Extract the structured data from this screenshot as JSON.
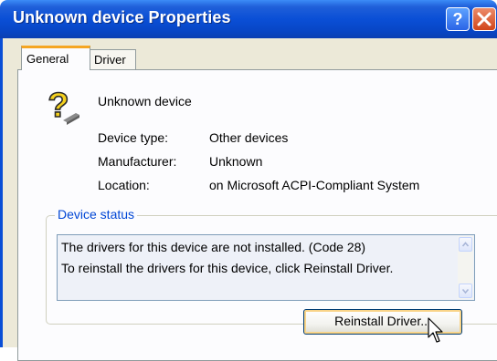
{
  "window": {
    "title": "Unknown device Properties",
    "help_icon": "question-mark-icon",
    "close_icon": "close-x-icon"
  },
  "tabs": [
    {
      "label": "General",
      "active": true
    },
    {
      "label": "Driver",
      "active": false
    }
  ],
  "device": {
    "icon": "unknown-device-question-icon",
    "name": "Unknown device"
  },
  "properties": [
    {
      "label": "Device type:",
      "value": "Other devices"
    },
    {
      "label": "Manufacturer:",
      "value": "Unknown"
    },
    {
      "label": "Location:",
      "value": "on Microsoft ACPI-Compliant System"
    }
  ],
  "device_status": {
    "title": "Device status",
    "lines": [
      "The drivers for this device are not installed. (Code 28)",
      "To reinstall the drivers for this device, click Reinstall Driver."
    ]
  },
  "reinstall_button_label": "Reinstall Driver...",
  "colors": {
    "titlebar": "#0a4fd6",
    "dialog_bg": "#ece9d8",
    "groupbox_title": "#0046d5",
    "tab_highlight": "#f5a623"
  }
}
